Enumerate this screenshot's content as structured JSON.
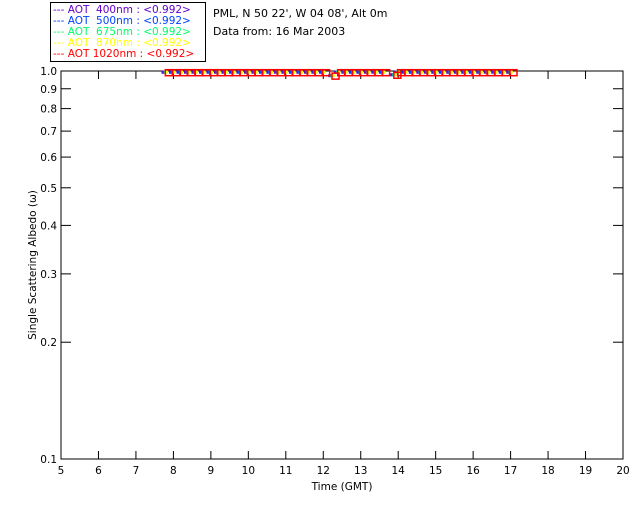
{
  "legend": [
    {
      "label": "--- AOT  400nm : <0.992>",
      "color": "#6600cc"
    },
    {
      "label": "--- AOT  500nm : <0.992>",
      "color": "#0044ff"
    },
    {
      "label": "--- AOT  675nm : <0.992>",
      "color": "#00ff66"
    },
    {
      "label": "--- AOT  870nm : <0.992>",
      "color": "#ffff00"
    },
    {
      "label": "--- AOT 1020nm : <0.992>",
      "color": "#ff0000"
    }
  ],
  "header": {
    "site": "PML, N 50 22', W 04 08', Alt 0m",
    "date": "Data from: 16 Mar 2003"
  },
  "chart_data": {
    "type": "scatter",
    "xlabel": "Time (GMT)",
    "ylabel": "Single Scattering Albedo (ω)",
    "xlim": [
      5,
      20
    ],
    "ylim": [
      0.1,
      1.0
    ],
    "yscale": "log",
    "xticks": [
      "5",
      "6",
      "7",
      "8",
      "9",
      "10",
      "11",
      "12",
      "13",
      "14",
      "15",
      "16",
      "17",
      "18",
      "19",
      "20"
    ],
    "yticks": [
      "0.1",
      "0.2",
      "0.3",
      "0.4",
      "0.5",
      "0.6",
      "0.7",
      "0.8",
      "0.9",
      "1.0"
    ],
    "grid": false,
    "series": [
      {
        "name": "AOT 400nm",
        "color": "#6600cc"
      },
      {
        "name": "AOT 500nm",
        "color": "#0044ff"
      },
      {
        "name": "AOT 675nm",
        "color": "#00ff66"
      },
      {
        "name": "AOT 870nm",
        "color": "#ffff00"
      },
      {
        "name": "AOT 1020nm",
        "color": "#ff0000"
      }
    ],
    "x": [
      7.8,
      8.0,
      8.2,
      8.4,
      8.6,
      8.8,
      9.0,
      9.2,
      9.4,
      9.6,
      9.8,
      10.0,
      10.2,
      10.4,
      10.6,
      10.8,
      11.0,
      11.2,
      11.4,
      11.6,
      11.8,
      12.0,
      12.25,
      12.4,
      12.6,
      12.8,
      13.0,
      13.2,
      13.4,
      13.6,
      13.9,
      14.0,
      14.2,
      14.4,
      14.6,
      14.8,
      15.0,
      15.2,
      15.4,
      15.6,
      15.8,
      16.0,
      16.2,
      16.4,
      16.6,
      16.8,
      17.0
    ],
    "y": [
      0.99,
      0.99,
      0.99,
      0.99,
      0.99,
      0.99,
      0.99,
      0.99,
      0.99,
      0.99,
      0.99,
      0.99,
      0.99,
      0.99,
      0.99,
      0.99,
      0.99,
      0.99,
      0.99,
      0.99,
      0.99,
      0.99,
      0.97,
      0.99,
      0.99,
      0.99,
      0.99,
      0.99,
      0.99,
      0.99,
      0.975,
      0.99,
      0.99,
      0.99,
      0.99,
      0.99,
      0.99,
      0.99,
      0.99,
      0.99,
      0.99,
      0.99,
      0.99,
      0.99,
      0.99,
      0.99,
      0.99
    ]
  }
}
